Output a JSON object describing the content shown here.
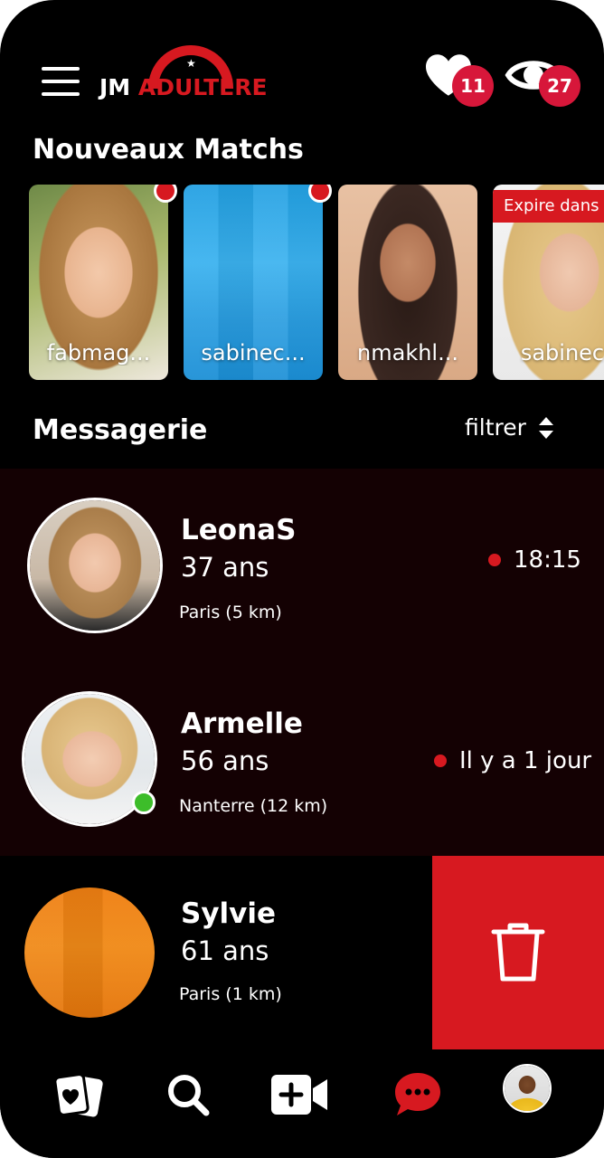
{
  "header": {
    "logo_jm": "JM",
    "logo_adultere": "ADULTERE",
    "likes_count": "11",
    "views_count": "27"
  },
  "matches": {
    "title": "Nouveaux Matchs",
    "items": [
      {
        "name": "fabmag...",
        "new": true
      },
      {
        "name": "sabinec...",
        "new": true
      },
      {
        "name": "nmakhl...",
        "new": false
      },
      {
        "name": "sabinec",
        "new": false,
        "banner": "Expire dans"
      }
    ]
  },
  "messaging": {
    "title": "Messagerie",
    "filter_label": "filtrer",
    "conversations": [
      {
        "name": "LeonaS",
        "age": "37 ans",
        "location": "Paris (5 km)",
        "time": "18:15",
        "online": false
      },
      {
        "name": "Armelle",
        "age": "56 ans",
        "location": "Nanterre (12 km)",
        "time": "Il y a 1 jour",
        "online": true
      },
      {
        "name": "Sylvie",
        "age": "61 ans",
        "location": "Paris (1 km)",
        "time": "",
        "online": false
      }
    ]
  },
  "colors": {
    "brand_red": "#d71920",
    "badge_red": "#d7173a",
    "online_green": "#3dbd2a",
    "unread_row_bg": "#140103"
  },
  "icons": {
    "menu": "hamburger-menu-icon",
    "likes": "heart-icon",
    "views": "eye-icon",
    "filter": "sort-arrows-icon",
    "delete": "trash-icon",
    "nav": [
      "cards-heart-icon",
      "search-icon",
      "video-add-icon",
      "chat-bubble-icon",
      "profile-avatar-icon"
    ]
  }
}
